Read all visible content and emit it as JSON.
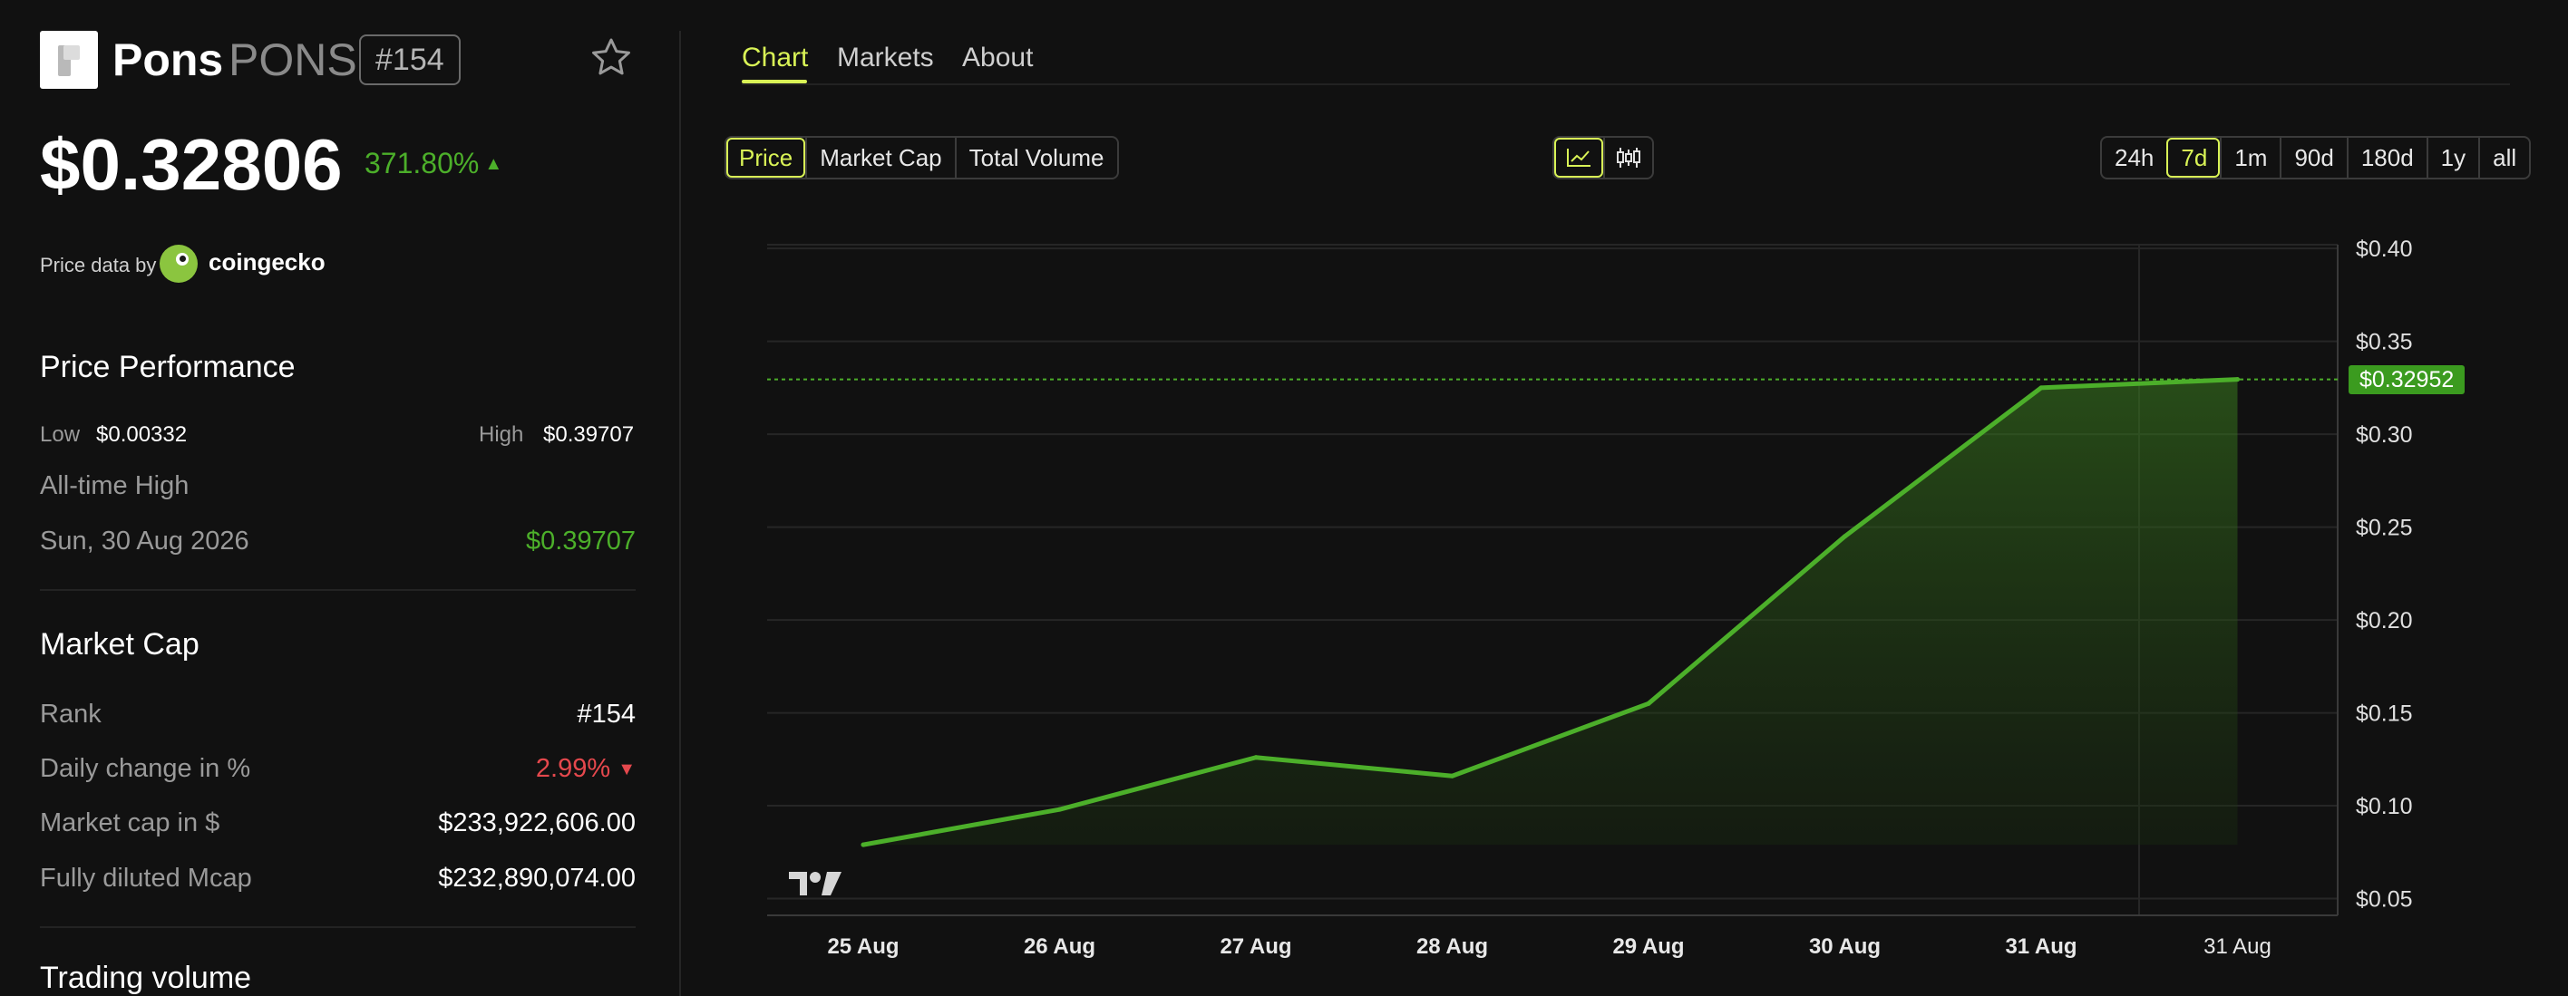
{
  "coin": {
    "name": "Pons",
    "symbol": "PONS",
    "rank_badge": "#154",
    "price": "$0.32806",
    "change_pct": "371.80%",
    "change_arrow": "▲"
  },
  "source": {
    "label": "Price data by",
    "provider": "coingecko"
  },
  "performance": {
    "title": "Price Performance",
    "low_label": "Low",
    "low_value": "$0.00332",
    "high_label": "High",
    "high_value": "$0.39707",
    "ath_label": "All-time High",
    "ath_date": "Sun, 30 Aug 2026",
    "ath_value": "$0.39707"
  },
  "market_cap": {
    "title": "Market Cap",
    "rows": [
      {
        "label": "Rank",
        "value": "#154"
      },
      {
        "label": "Daily change in %",
        "value": "2.99%",
        "arrow": "▼"
      },
      {
        "label": "Market cap in $",
        "value": "$233,922,606.00"
      },
      {
        "label": "Fully diluted Mcap",
        "value": "$232,890,074.00"
      }
    ]
  },
  "trading_volume": {
    "title": "Trading volume"
  },
  "tabs": [
    {
      "label": "Chart",
      "active": true
    },
    {
      "label": "Markets",
      "active": false
    },
    {
      "label": "About",
      "active": false
    }
  ],
  "metric_buttons": [
    {
      "label": "Price",
      "active": true
    },
    {
      "label": "Market Cap",
      "active": false
    },
    {
      "label": "Total Volume",
      "active": false
    }
  ],
  "chart_types": [
    {
      "icon": "line-chart-icon",
      "active": true
    },
    {
      "icon": "candlestick-icon",
      "active": false
    }
  ],
  "ranges": [
    {
      "label": "24h",
      "active": false
    },
    {
      "label": "7d",
      "active": true
    },
    {
      "label": "1m",
      "active": false
    },
    {
      "label": "90d",
      "active": false
    },
    {
      "label": "180d",
      "active": false
    },
    {
      "label": "1y",
      "active": false
    },
    {
      "label": "all",
      "active": false
    }
  ],
  "colors": {
    "accent": "#d9f356",
    "line": "#4caf2a",
    "negative": "#e5484d",
    "background": "#111111"
  },
  "chart_data": {
    "type": "area",
    "x": [
      "25 Aug",
      "26 Aug",
      "27 Aug",
      "28 Aug",
      "29 Aug",
      "30 Aug",
      "31 Aug",
      "31 Aug"
    ],
    "values": [
      0.079,
      0.098,
      0.126,
      0.116,
      0.155,
      0.245,
      0.325,
      0.3295
    ],
    "y_ticks": [
      "$0.05",
      "$0.10",
      "$0.15",
      "$0.20",
      "$0.25",
      "$0.30",
      "$0.35",
      "$0.40"
    ],
    "y_tick_values": [
      0.05,
      0.1,
      0.15,
      0.2,
      0.25,
      0.3,
      0.35,
      0.4
    ],
    "ylim": [
      0.041,
      0.402
    ],
    "current_value": 0.32952,
    "current_label": "$0.32952",
    "grid": true,
    "title": "",
    "xlabel": "",
    "ylabel": ""
  }
}
